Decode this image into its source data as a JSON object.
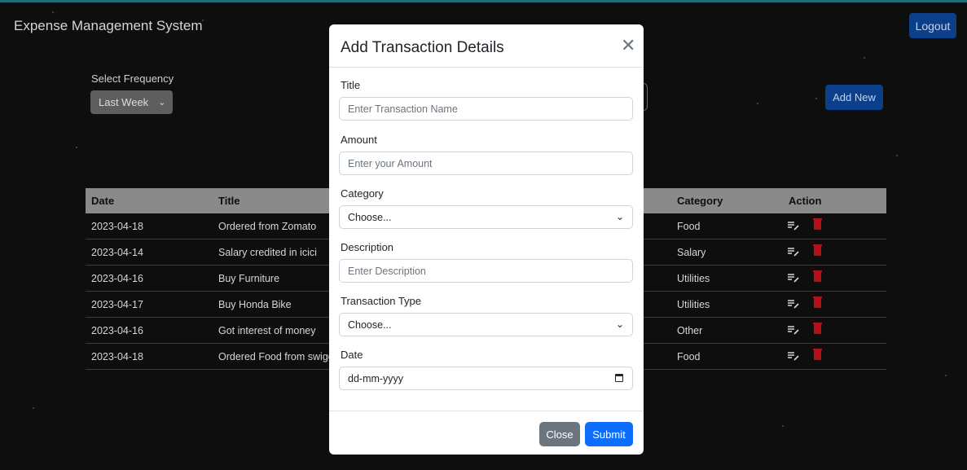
{
  "app": {
    "title": "Expense Management System",
    "logout_label": "Logout"
  },
  "filters": {
    "frequency_label": "Select Frequency",
    "frequency_value": "Last Week"
  },
  "actions": {
    "add_new_label": "Add New"
  },
  "table": {
    "headers": {
      "date": "Date",
      "title": "Title",
      "category": "Category",
      "action": "Action"
    },
    "rows": [
      {
        "date": "2023-04-18",
        "title": "Ordered from Zomato",
        "category": "Food"
      },
      {
        "date": "2023-04-14",
        "title": "Salary credited in icici",
        "category": "Salary"
      },
      {
        "date": "2023-04-16",
        "title": "Buy Furniture",
        "category": "Utilities"
      },
      {
        "date": "2023-04-17",
        "title": "Buy Honda Bike",
        "category": "Utilities"
      },
      {
        "date": "2023-04-16",
        "title": "Got interest of money",
        "category": "Other"
      },
      {
        "date": "2023-04-18",
        "title": "Ordered Food from swigg",
        "category": "Food"
      }
    ]
  },
  "modal": {
    "title": "Add Transaction Details",
    "title_field": {
      "label": "Title",
      "placeholder": "Enter Transaction Name"
    },
    "amount_field": {
      "label": "Amount",
      "placeholder": "Enter your Amount"
    },
    "category_field": {
      "label": "Category",
      "value": "Choose..."
    },
    "description_field": {
      "label": "Description",
      "placeholder": "Enter Description"
    },
    "type_field": {
      "label": "Transaction Type",
      "value": "Choose..."
    },
    "date_field": {
      "label": "Date",
      "value": "dd-mm-yyyy"
    },
    "close_label": "Close",
    "submit_label": "Submit"
  },
  "icons": {
    "edit": "edit-list-icon",
    "delete": "trash-icon",
    "close": "close-icon",
    "chevron": "chevron-down-icon",
    "calendar": "calendar-icon"
  },
  "colors": {
    "primary": "#0d6efd",
    "danger": "#b3121a",
    "secondary": "#6c757d"
  }
}
